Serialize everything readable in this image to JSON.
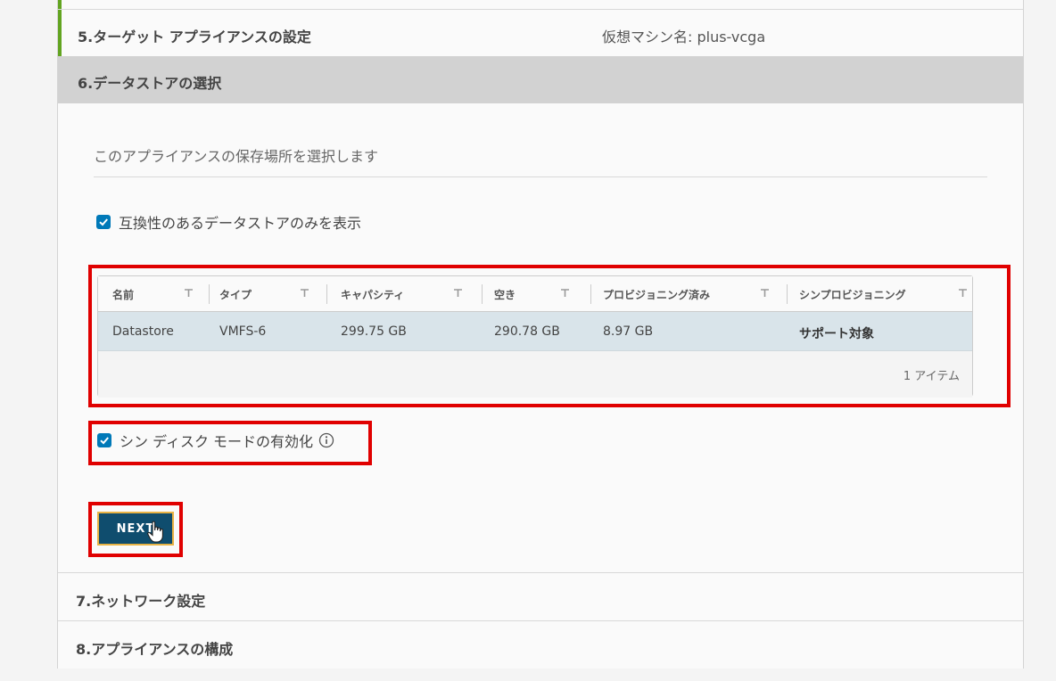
{
  "steps": {
    "step5": {
      "title": "5.ターゲット アプライアンスの設定",
      "vm_name": "仮想マシン名: plus-vcga"
    },
    "step6": {
      "title": "6.データストアの選択",
      "description": "このアプライアンスの保存場所を選択します",
      "compat_checkbox_label": "互換性のあるデータストアのみを表示",
      "compat_checked": true,
      "grid": {
        "columns": [
          "名前",
          "タイプ",
          "キャパシティ",
          "空き",
          "プロビジョニング済み",
          "シンプロビジョニング"
        ],
        "rows": [
          [
            "Datastore",
            "VMFS-6",
            "299.75 GB",
            "290.78 GB",
            "8.97 GB",
            "サポート対象"
          ]
        ],
        "footer_count": "1 アイテム"
      },
      "thin_disk_label": "シン ディスク モードの有効化",
      "thin_disk_checked": true,
      "next_label": "NEXT"
    },
    "step7": {
      "title": "7.ネットワーク設定"
    },
    "step8": {
      "title": "8.アプライアンスの構成"
    }
  },
  "colors": {
    "accent_green": "#62a420",
    "checkbox_blue": "#0079b8",
    "next_button": "#0f4d6e",
    "highlight_red": "#e00000",
    "selected_row": "#d9e4ea"
  },
  "icons": [
    "check-icon",
    "filter-icon",
    "info-icon",
    "hand-cursor-icon"
  ]
}
